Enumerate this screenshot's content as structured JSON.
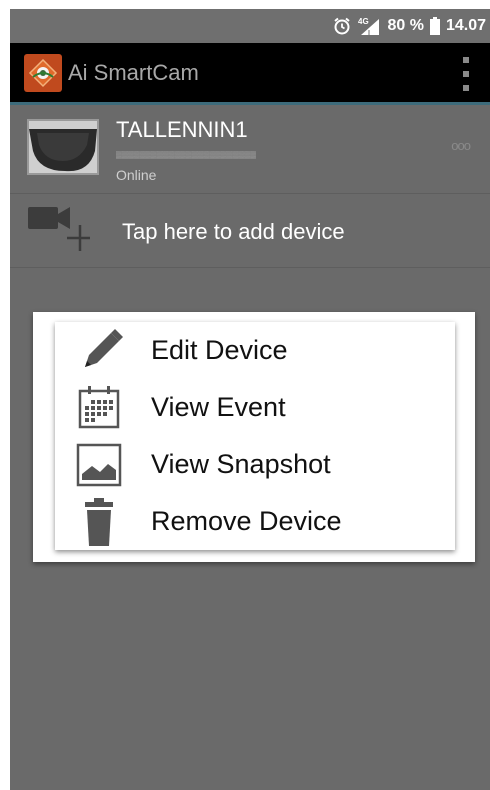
{
  "status_bar": {
    "network": "4G",
    "battery": "80 %",
    "time": "14.07"
  },
  "app_bar": {
    "title": "Ai SmartCam"
  },
  "device": {
    "name": "TALLENNIN1",
    "status": "Online",
    "more": "ooo"
  },
  "add_device": {
    "label": "Tap here to add device"
  },
  "context_menu": {
    "items": [
      {
        "label": "Edit Device",
        "icon": "pencil-icon"
      },
      {
        "label": "View Event",
        "icon": "calendar-icon"
      },
      {
        "label": "View Snapshot",
        "icon": "image-icon"
      },
      {
        "label": "Remove Device",
        "icon": "trash-icon"
      }
    ]
  },
  "colors": {
    "status_bar": "#6f6f6f",
    "app_bar": "#000000",
    "app_bar_accent": "#3d6b7b",
    "logo": "#c04a1e",
    "content_overlay": "#6a6a6a",
    "menu_icon": "#555555"
  }
}
